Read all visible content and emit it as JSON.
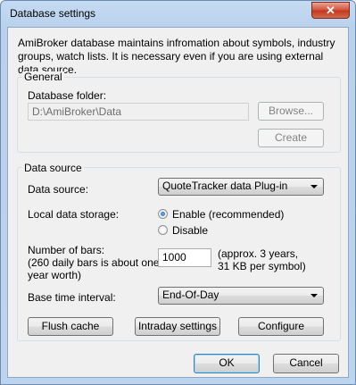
{
  "window": {
    "title": "Database settings",
    "close_glyph": "✕"
  },
  "description": "AmiBroker database maintains infromation about symbols, industry groups, watch lists. It is necessary even if you are using external data source.",
  "general": {
    "group_title": "General",
    "folder_label": "Database folder:",
    "folder_value": "D:\\AmiBroker\\Data",
    "browse_label": "Browse...",
    "create_label": "Create"
  },
  "data_source": {
    "group_title": "Data source",
    "source_label": "Data source:",
    "source_value": "QuoteTracker data Plug-in",
    "storage_label": "Local data storage:",
    "enable_label": "Enable (recommended)",
    "disable_label": "Disable",
    "bars_label_line1": "Number of bars:",
    "bars_label_line2": "(260 daily bars is about one",
    "bars_label_line3": "year worth)",
    "bars_value": "1000",
    "bars_hint_line1": "(approx. 3 years,",
    "bars_hint_line2": "31 KB per symbol)",
    "interval_label": "Base time interval:",
    "interval_value": "End-Of-Day",
    "flush_label": "Flush cache",
    "intraday_label": "Intraday settings",
    "configure_label": "Configure"
  },
  "footer": {
    "ok_label": "OK",
    "cancel_label": "Cancel"
  }
}
